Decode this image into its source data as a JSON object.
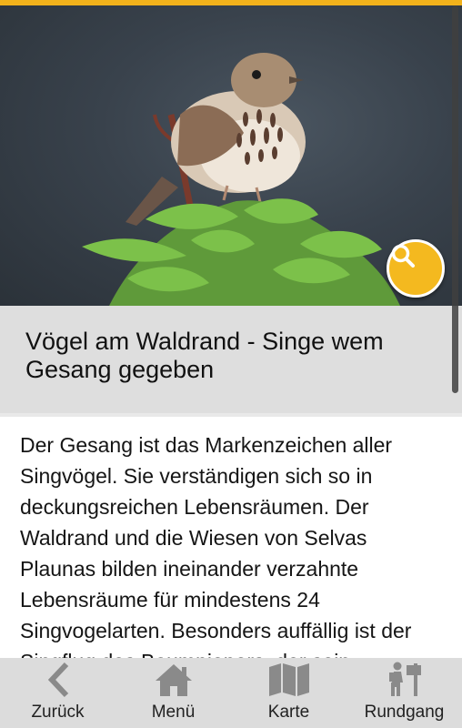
{
  "article": {
    "title": "Vögel am Waldrand - Singe wem Gesang gegeben",
    "text": "Der Gesang ist das Markenzeichen aller Singvögel. Sie verständigen sich so in deckungsreichen Lebensräumen. Der Waldrand und die Wiesen von Selvas Plaunas bilden ineinander verzahnte Lebensräume für mindestens 24 Singvogelarten. Besonders auffällig ist der Singflug des Baumpiepers, der sein"
  },
  "hero": {
    "zoom_icon": "search-icon"
  },
  "nav": {
    "items": [
      {
        "label": "Zurück",
        "icon": "chevron-left-icon"
      },
      {
        "label": "Menü",
        "icon": "home-icon"
      },
      {
        "label": "Karte",
        "icon": "map-icon"
      },
      {
        "label": "Rundgang",
        "icon": "hiker-signpost-icon"
      }
    ]
  },
  "colors": {
    "accent": "#f4b91f",
    "title_band": "#dedede",
    "tabbar": "#dcdcdc",
    "icon": "#8a8a8a"
  }
}
